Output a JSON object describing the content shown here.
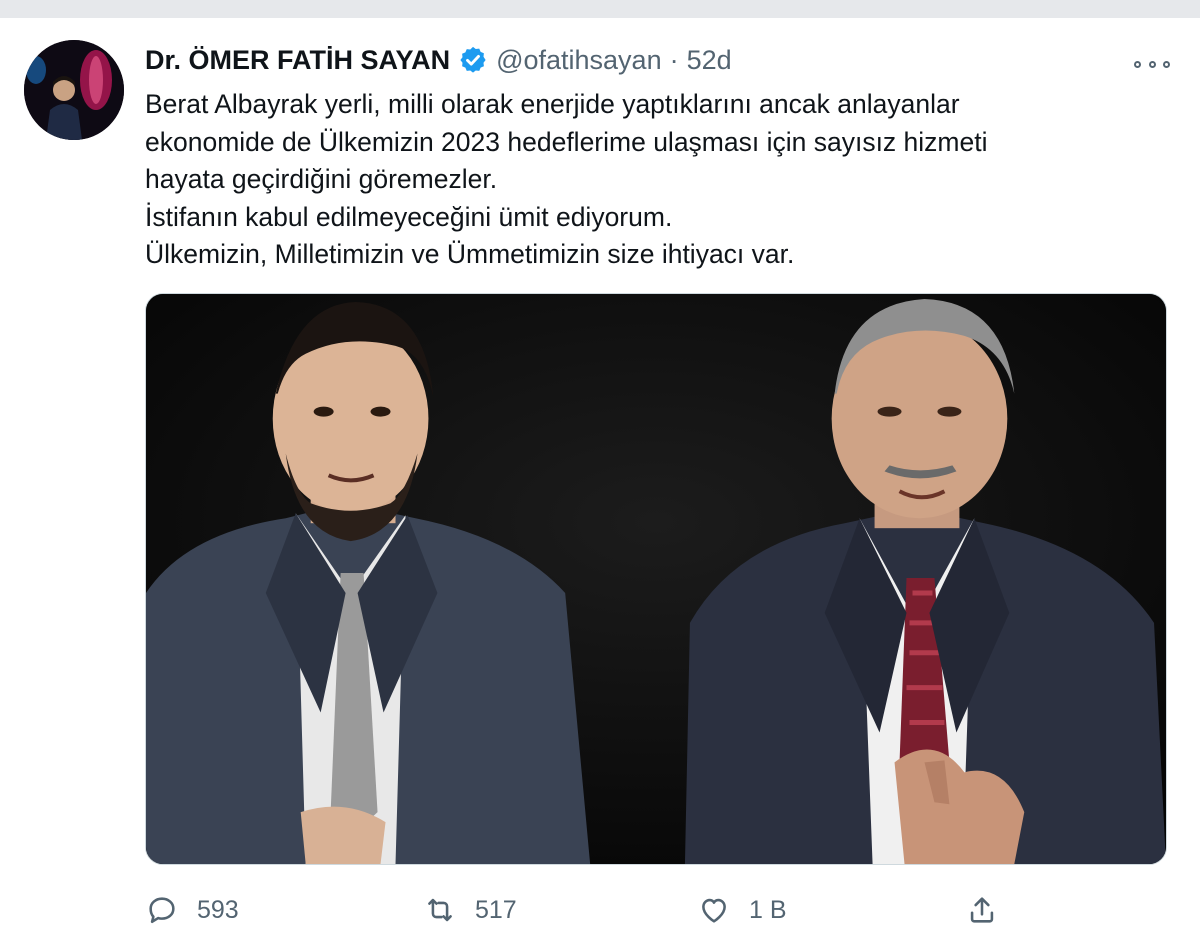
{
  "tweet": {
    "display_name": "Dr. ÖMER FATİH SAYAN",
    "verified": true,
    "handle": "@ofatihsayan",
    "separator": "·",
    "time": "52d",
    "text_lines": [
      "Berat Albayrak yerli, milli olarak enerjide yaptıklarını ancak anlayanlar",
      "ekonomide de Ülkemizin 2023 hedeflerime ulaşması için sayısız hizmeti",
      "hayata geçirdiğini göremezler.",
      "İstifanın kabul edilmeyeceğini ümit ediyorum.",
      "Ülkemizin, Milletimizin ve Ümmetimizin size ihtiyacı var."
    ],
    "actions": {
      "reply_count": "593",
      "retweet_count": "517",
      "like_count": "1 B"
    }
  },
  "icons": {
    "verified": "verified-badge-icon",
    "more": "more-options-icon",
    "reply": "reply-icon",
    "retweet": "retweet-icon",
    "like": "heart-icon",
    "share": "share-icon"
  },
  "colors": {
    "accent": "#1d9bf0",
    "text": "#0f1419",
    "secondary": "#536471",
    "background": "#ffffff",
    "top_band": "#e6e8eb"
  }
}
